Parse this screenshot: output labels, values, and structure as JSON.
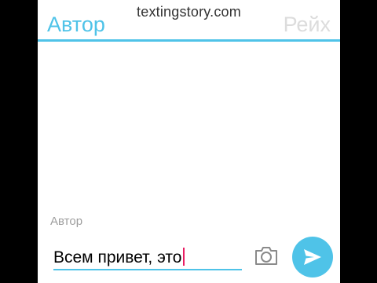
{
  "watermark": "textingstory.com",
  "header": {
    "left_tab": "Автор",
    "right_tab": "Рейх"
  },
  "composer": {
    "sender_label": "Автор",
    "text": "Всем привет, это"
  },
  "icons": {
    "camera": "camera-icon",
    "send": "send-icon"
  },
  "colors": {
    "accent": "#4fc3e8",
    "tab_active": "#4fc3e8",
    "tab_inactive": "#dcdcdc",
    "label_gray": "#9e9e9e",
    "icon_gray": "#8a8a8a",
    "caret": "#e91e63"
  }
}
